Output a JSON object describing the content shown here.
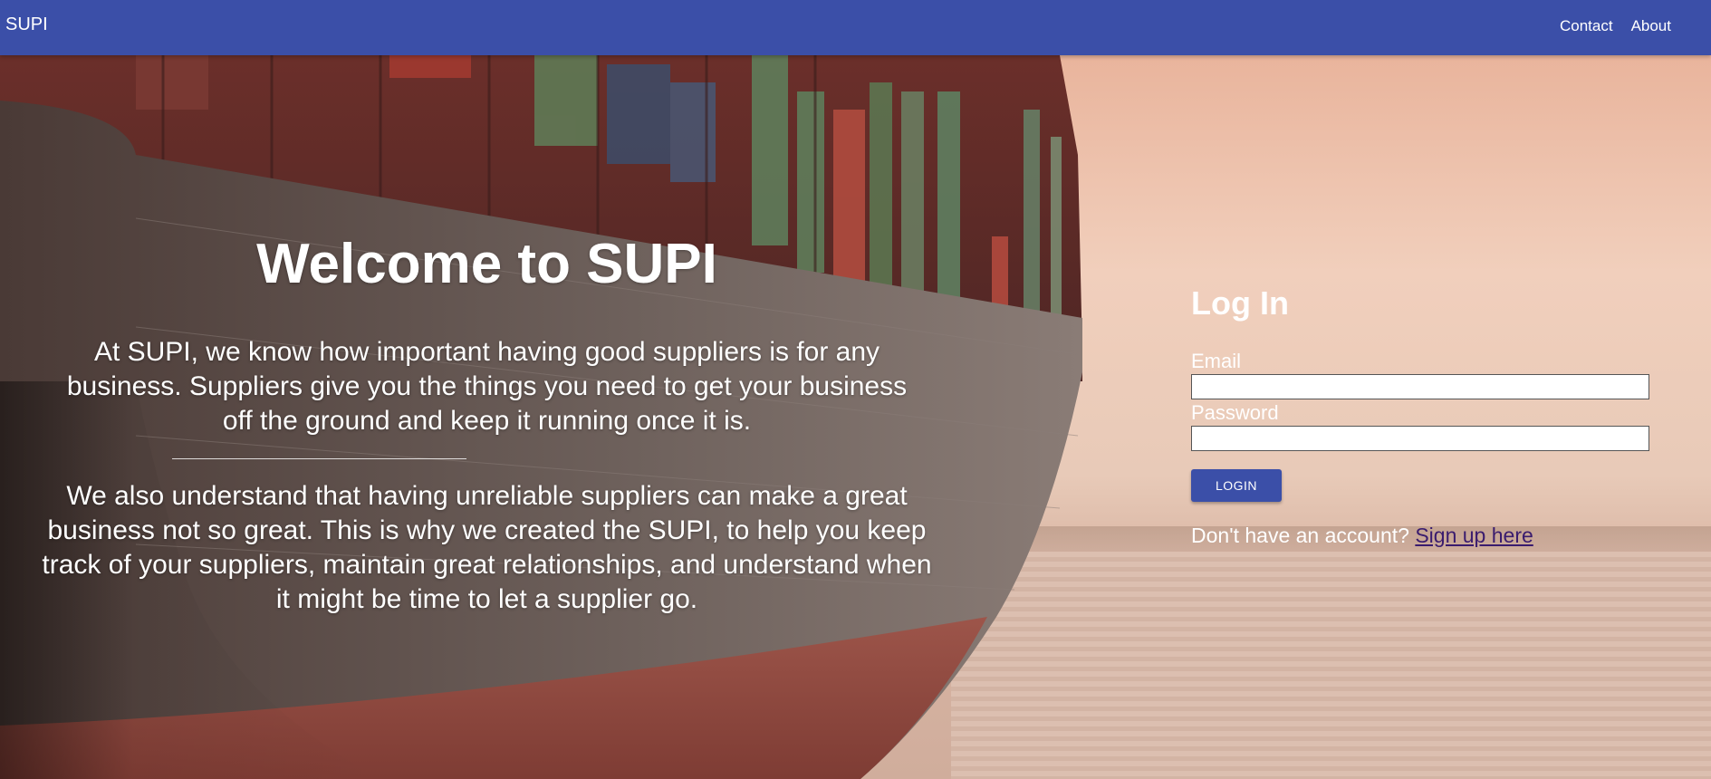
{
  "header": {
    "brand": "SUPI",
    "nav": [
      "Contact",
      "About"
    ]
  },
  "hero": {
    "title": "Welcome to SUPI",
    "paragraph1": "At SUPI, we know how important having good suppliers is for any business. Suppliers give you the things you need to get your business off the ground and keep it running once it is.",
    "paragraph2": "We also understand that having unreliable suppliers can make a great business not so great. This is why we created the SUPI, to help you keep track of your suppliers, maintain great relationships, and understand when it might be time to let a supplier go."
  },
  "login": {
    "title": "Log In",
    "email_label": "Email",
    "email_value": "",
    "password_label": "Password",
    "password_value": "",
    "button": "LOGIN",
    "signup_prompt": "Don't have an account?",
    "signup_link": "Sign up here"
  },
  "colors": {
    "appbar": "#3b4fa8",
    "button": "#3b4fa8",
    "link": "#3a1c6e",
    "text": "#ffffff"
  }
}
